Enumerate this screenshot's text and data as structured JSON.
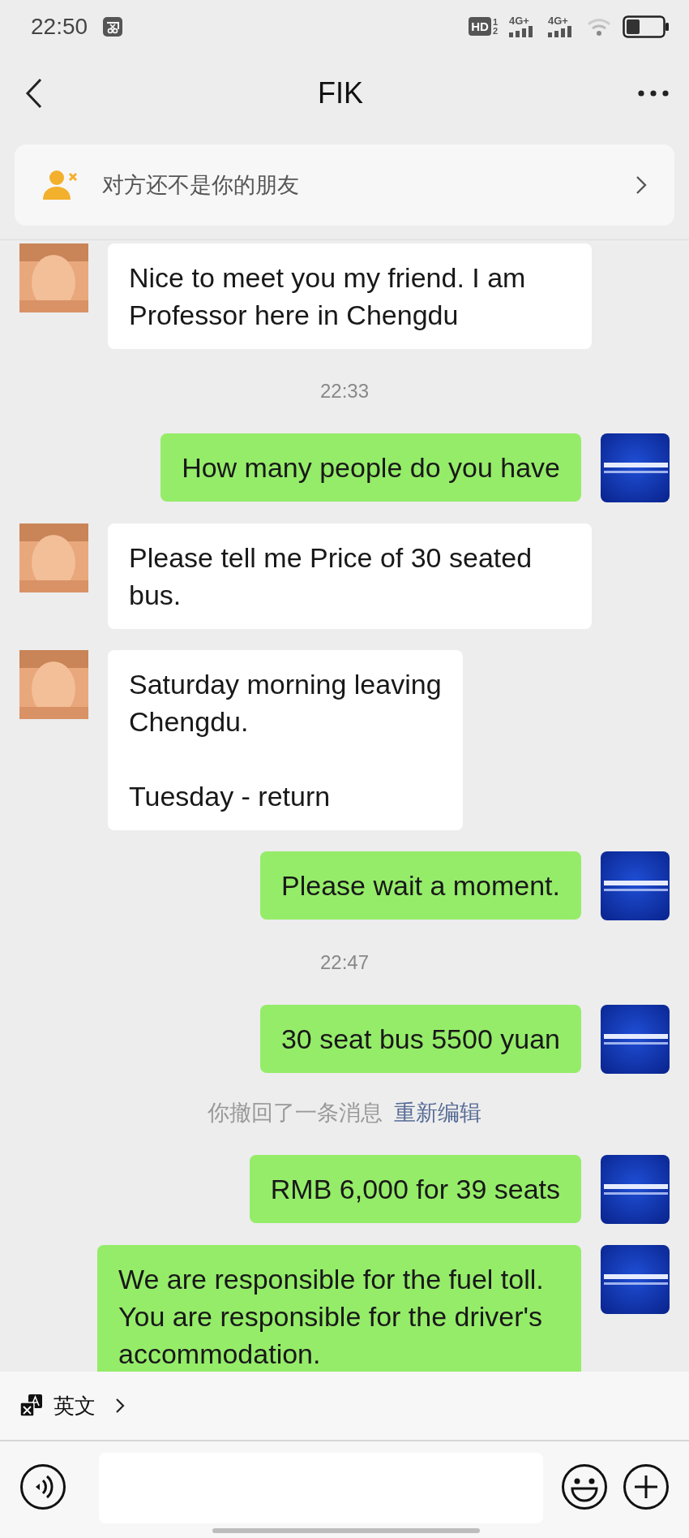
{
  "status_bar": {
    "time": "22:50",
    "hd": "HD",
    "sim_slots": [
      "1",
      "2"
    ],
    "networks": [
      "4G+",
      "4G+"
    ]
  },
  "header": {
    "title": "FIK"
  },
  "banner": {
    "text": "对方还不是你的朋友"
  },
  "messages": [
    {
      "kind": "received",
      "text": "Nice to meet you my friend. I am Professor here in Chengdu"
    },
    {
      "kind": "time",
      "text": "22:33"
    },
    {
      "kind": "sent",
      "text": "How many people do you have"
    },
    {
      "kind": "received",
      "text": "Please tell me Price of 30 seated bus."
    },
    {
      "kind": "received",
      "text": "Saturday morning leaving\nChengdu.\n\nTuesday - return"
    },
    {
      "kind": "sent",
      "text": "Please wait a moment."
    },
    {
      "kind": "time",
      "text": "22:47"
    },
    {
      "kind": "sent",
      "text": "30 seat bus 5500 yuan"
    },
    {
      "kind": "recall",
      "text": "你撤回了一条消息",
      "link": "重新编辑"
    },
    {
      "kind": "sent",
      "text": "RMB 6,000 for 39 seats"
    },
    {
      "kind": "sent",
      "text": "We are responsible for the fuel toll. You are responsible for the driver's accommodation."
    }
  ],
  "translate_bar": {
    "label": "英文"
  }
}
